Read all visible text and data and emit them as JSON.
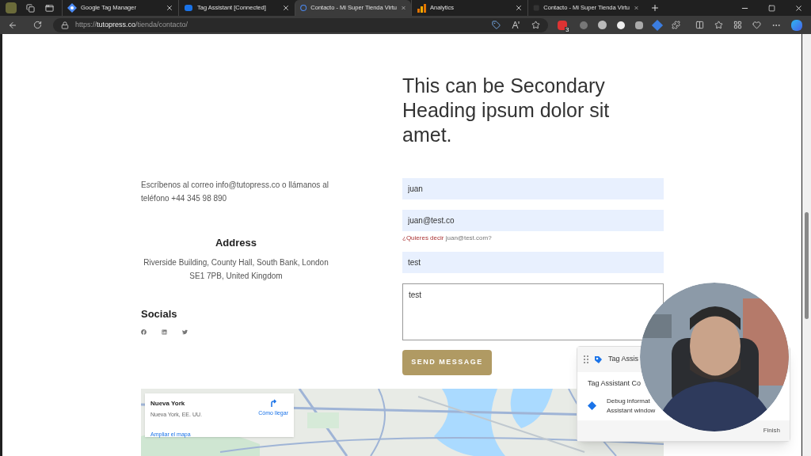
{
  "browser": {
    "tabs": [
      {
        "title": "Google Tag Manager",
        "kind": "gtm",
        "selected": false
      },
      {
        "title": "Tag Assistant [Connected]",
        "kind": "tag",
        "selected": false
      },
      {
        "title": "Contacto - Mi Super Tienda Virtu",
        "kind": "page",
        "selected": true
      },
      {
        "title": "Analytics",
        "kind": "analytics",
        "selected": false
      },
      {
        "title": "Contacto - Mi Super Tienda Virtu",
        "kind": "dark",
        "selected": false
      }
    ],
    "url": {
      "scheme": "https://",
      "host": "tutopress.co",
      "path": "/tienda/contacto/"
    },
    "extension_badge": "3"
  },
  "page": {
    "heading": "This can be Secondary Heading ipsum dolor sit amet.",
    "contact_text": "Escríbenos al correo info@tutopress.co o llámanos al teléfono +44 345 98 890",
    "address_title": "Address",
    "address": "Riverside Building, County Hall, South Bank, London SE1 7PB, United Kingdom",
    "socials_title": "Socials",
    "form": {
      "name": "juan",
      "email": "juan@test.co",
      "suggestion_prefix": "¿Quieres decir",
      "suggestion_value": "juan@test.com?",
      "subject": "test",
      "message": "test",
      "submit": "SEND MESSAGE"
    },
    "map": {
      "place": "Nueva York",
      "region": "Nueva York, EE. UU.",
      "directions": "Cómo llegar",
      "enlarge": "Ampliar el mapa"
    }
  },
  "tag_assistant": {
    "title": "Tag Assis",
    "subtitle": "Tag Assistant Co",
    "message_lines": [
      "Debug informat",
      "Assistant window"
    ],
    "finish": "Finish"
  }
}
